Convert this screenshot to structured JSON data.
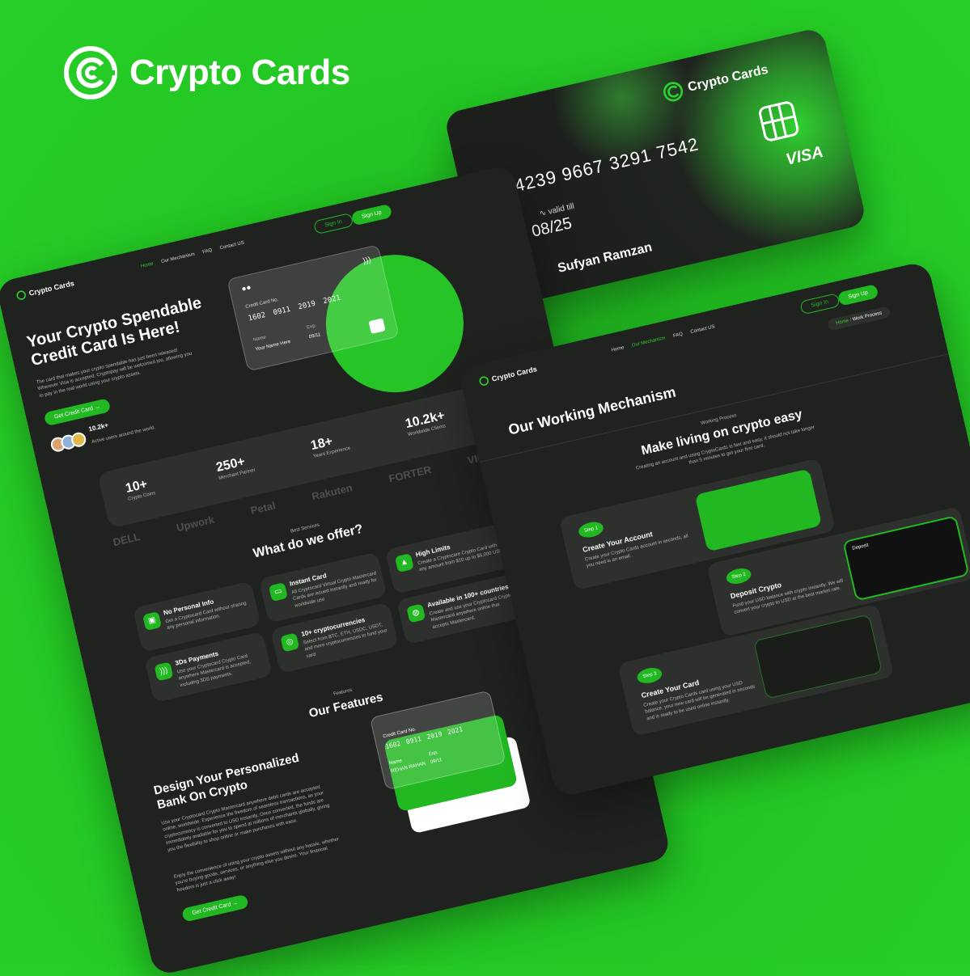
{
  "brand": {
    "name": "Crypto Cards"
  },
  "card": {
    "brand": "Crypto Cards",
    "number": "4239 9667 3291 7542",
    "valid_label": "valid till",
    "expiry": "08/25",
    "holder": "Sufyan Ramzan",
    "network": "VISA"
  },
  "left": {
    "nav": {
      "logo": "Crypto Cards",
      "items": [
        "Home",
        "Our Mechanism",
        "FAQ",
        "Contact US"
      ],
      "sign_in": "Sign In",
      "sign_up": "Sign Up"
    },
    "hero": {
      "title_line1": "Your Crypto Spendable",
      "title_line2": "Credit Card Is Here!",
      "desc": "The card that makes your crypto spendable has just been released! Wherever Visa is accepted, Cryptopay will be welcomed too, allowing you to pay in the real world using your crypto assets.",
      "cta": "Get Credit Card",
      "users_count": "10.2k+",
      "users_label": "Active users around the world."
    },
    "glass_card": {
      "label": "Credit Card No.",
      "number": [
        "1602",
        "0911",
        "2019",
        "2021"
      ],
      "name_label": "Name",
      "name": "Your Name Here",
      "exp_label": "Exp.",
      "exp": "09/11"
    },
    "stats": [
      {
        "value": "10+",
        "label": "Crypto Coins"
      },
      {
        "value": "250+",
        "label": "Merchant Partner"
      },
      {
        "value": "18+",
        "label": "Years Experience"
      },
      {
        "value": "10.2k+",
        "label": "Worldwide Clients"
      }
    ],
    "logos": [
      "DELL",
      "Upwork",
      "Petal",
      "Rakuten",
      "FORTER",
      "VICE"
    ],
    "offer": {
      "eyebrow": "Best Services",
      "title": "What do we offer?",
      "items": [
        {
          "title": "No Personal Info",
          "desc": "Get a Cryptocard Card without sharing any personal information."
        },
        {
          "title": "Instant Card",
          "desc": "All Cryptocard Virtual Crypto Mastercard Cards are issued instantly and ready for worldwide use"
        },
        {
          "title": "High Limits",
          "desc": "Create a Cryptocare Crypto Card with any amount from $10 up to $5,000 USD"
        },
        {
          "title": "3Ds Payments",
          "desc": "Use your Cryptocard Crypto Card anywhere Mastercard is accepted, including 3DS payments."
        },
        {
          "title": "10+ cryptocurrencies",
          "desc": "Select from BTC, ETH, USDC, USDT, and more cryptocurrencies to fund your card"
        },
        {
          "title": "Available in 100+ countries",
          "desc": "Create and use your Cryptocard Crypto Mastercard anywhere online that accepts Mastercard."
        }
      ]
    },
    "features": {
      "eyebrow": "Features",
      "title": "Our Features",
      "h_line1": "Design Your Personalized",
      "h_line2": "Bank On Crypto",
      "p1": "Use your Cryptocard Crypto Mastercard anywhere debit cards are accepted online, worldwide. Experience the freedom of seamless transactions, as your cryptocurrency is converted to USD instantly. Once converted, the funds are immediately available for you to spend at millions of merchants globally, giving you the flexibility to shop online or make purchases with ease.",
      "p2": "Enjoy the convenience of using your crypto assets without any hassle, whether you're buying goods, services, or anything else you desire. Your financial freedom is just a click away!",
      "cta": "Get Credit Card",
      "card": {
        "label": "Credit Card No.",
        "number": [
          "1602",
          "0911",
          "2019",
          "2021"
        ],
        "name_label": "Name",
        "name": "REHAN RAHAN",
        "exp_label": "Exp.",
        "exp": "09/11"
      }
    }
  },
  "right": {
    "nav": {
      "logo": "Crypto Cards",
      "items": [
        "Home",
        "Our Mechanism",
        "FAQ",
        "Contact US"
      ],
      "sign_in": "Sign In",
      "sign_up": "Sign Up",
      "crumb_home": "Home",
      "crumb_sep": "/",
      "crumb_current": "Work Process"
    },
    "title": "Our Working Mechanism",
    "eyebrow": "Working Process",
    "headline": "Make living on crypto easy",
    "sub": "Creating an account and using CryptoCards is fast and easy, it should not take longer than 5 minutes to get your first card.",
    "steps": [
      {
        "badge": "Step 1",
        "title": "Create Your Account",
        "desc": "Create your Crypto Cards account in seconds, all you need is an email."
      },
      {
        "badge": "Step 2",
        "title": "Deposit Crypto",
        "desc": "Fund your USD balance with crypto instantly. We will convert your crypto to USD at the best market rate."
      },
      {
        "badge": "Step 3",
        "title": "Create Your Card",
        "desc": "Create your Crypto Cards card using your USD balance, your new card will be generated in seconds and is ready to be used online instantly."
      }
    ],
    "deposit_label": "Deposit"
  },
  "colors": {
    "accent": "#22b822",
    "bg": "#26c926",
    "panel": "#1f221f"
  }
}
